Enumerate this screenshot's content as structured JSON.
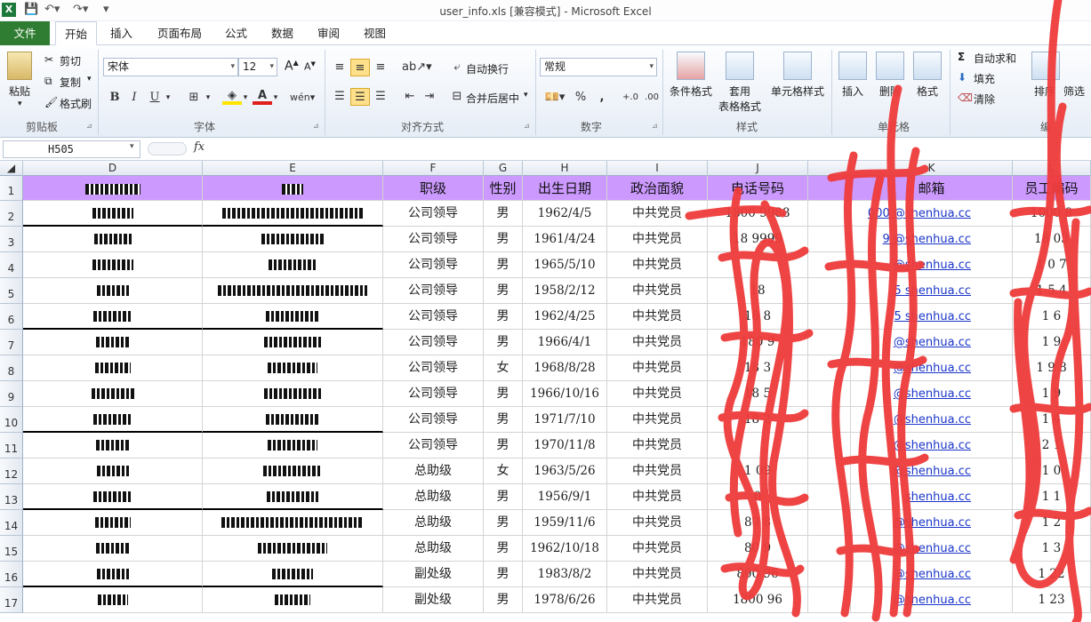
{
  "window": {
    "title": "user_info.xls  [兼容模式]  -  Microsoft Excel"
  },
  "tabs": [
    "文件",
    "开始",
    "插入",
    "页面布局",
    "公式",
    "数据",
    "审阅",
    "视图"
  ],
  "ribbon": {
    "clipboard": {
      "paste": "粘贴",
      "cut": "剪切",
      "copy": "复制",
      "format_painter": "格式刷",
      "label": "剪贴板"
    },
    "font": {
      "name": "宋体",
      "size": "12",
      "label": "字体",
      "bold": "B",
      "italic": "I",
      "underline": "U"
    },
    "alignment": {
      "wrap": "自动换行",
      "merge": "合并后居中",
      "label": "对齐方式"
    },
    "number": {
      "format": "常规",
      "label": "数字",
      "percent": "%",
      "comma": ","
    },
    "styles": {
      "conditional": "条件格式",
      "table1": "套用",
      "table2": "表格格式",
      "cell_styles": "单元格样式",
      "label": "样式"
    },
    "cells": {
      "insert": "插入",
      "delete": "删除",
      "format": "格式",
      "label": "单元格"
    },
    "editing": {
      "autosum": "自动求和",
      "fill": "填充",
      "clear": "清除",
      "sort": "排序",
      "filter": "筛选",
      "label": "编"
    }
  },
  "formula_bar": {
    "name_box": "H505",
    "fx": "fx",
    "content": ""
  },
  "columns": [
    "D",
    "E",
    "F",
    "G",
    "H",
    "I",
    "J",
    "",
    "K",
    "L"
  ],
  "headers": {
    "F": "职级",
    "G": "性别",
    "H": "出生日期",
    "I": "政治面貌",
    "J": "电话号码",
    "K": "邮箱",
    "L": "员工编码"
  },
  "rows": [
    {
      "n": "1"
    },
    {
      "n": "2",
      "F": "公司领导",
      "G": "男",
      "H": "1962/4/5",
      "I": "中共党员",
      "J": "1800  9988",
      "K": "000  @shenhua.cc",
      "L": "1000  8"
    },
    {
      "n": "3",
      "F": "公司领导",
      "G": "男",
      "H": "1961/4/24",
      "I": "中共党员",
      "J": "18  9999",
      "K": "9  @shenhua.cc",
      "L": "18  03"
    },
    {
      "n": "4",
      "F": "公司领导",
      "G": "男",
      "H": "1965/5/10",
      "I": "中共党员",
      "J": "",
      "K": "@shenhua.cc",
      "L": "1  0  7"
    },
    {
      "n": "5",
      "F": "公司领导",
      "G": "男",
      "H": "1958/2/12",
      "I": "中共党员",
      "J": "18",
      "K": "5  shenhua.cc",
      "L": "1  5  4"
    },
    {
      "n": "6",
      "F": "公司领导",
      "G": "男",
      "H": "1962/4/25",
      "I": "中共党员",
      "J": "18  8",
      "K": "5  shenhua.cc",
      "L": "1  6"
    },
    {
      "n": "7",
      "F": "公司领导",
      "G": "男",
      "H": "1966/4/1",
      "I": "中共党员",
      "J": "180  9",
      "K": "@shenhua.cc",
      "L": "1  9"
    },
    {
      "n": "8",
      "F": "公司领导",
      "G": "女",
      "H": "1968/8/28",
      "I": "中共党员",
      "J": "18  3",
      "K": "@shenhua.cc",
      "L": "1  9  8"
    },
    {
      "n": "9",
      "F": "公司领导",
      "G": "男",
      "H": "1966/10/16",
      "I": "中共党员",
      "J": "18  5",
      "K": "@shenhua.cc",
      "L": "1  9"
    },
    {
      "n": "10",
      "F": "公司领导",
      "G": "男",
      "H": "1971/7/10",
      "I": "中共党员",
      "J": "18  2",
      "K": "@shenhua.cc",
      "L": "1  4"
    },
    {
      "n": "11",
      "F": "公司领导",
      "G": "男",
      "H": "1970/11/8",
      "I": "中共党员",
      "J": "",
      "K": "@shenhua.cc",
      "L": "2  1"
    },
    {
      "n": "12",
      "F": "总助级",
      "G": "女",
      "H": "1963/5/26",
      "I": "中共党员",
      "J": "1  09",
      "K": "@shenhua.cc",
      "L": "1  0"
    },
    {
      "n": "13",
      "F": "总助级",
      "G": "男",
      "H": "1956/9/1",
      "I": "中共党员",
      "J": "0",
      "K": "shenhua.cc",
      "L": "1  1"
    },
    {
      "n": "14",
      "F": "总助级",
      "G": "男",
      "H": "1959/11/6",
      "I": "中共党员",
      "J": "80  8",
      "K": "@shenhua.cc",
      "L": "1  2"
    },
    {
      "n": "15",
      "F": "总助级",
      "G": "男",
      "H": "1962/10/18",
      "I": "中共党员",
      "J": "80  9",
      "K": "@shenhua.cc",
      "L": "1  3"
    },
    {
      "n": "16",
      "F": "副处级",
      "G": "男",
      "H": "1983/8/2",
      "I": "中共党员",
      "J": "800  96",
      "K": "@shenhua.cc",
      "L": "1  22"
    },
    {
      "n": "17",
      "F": "副处级",
      "G": "男",
      "H": "1978/6/26",
      "I": "中共党员",
      "J": "1800  96",
      "K": "@shenhua.cc",
      "L": "1  23"
    }
  ],
  "colors": {
    "header_fill": "#cc99ff",
    "file_tab": "#2f7d32",
    "scribble": "#ef3b3b",
    "link": "#1a35c9"
  }
}
